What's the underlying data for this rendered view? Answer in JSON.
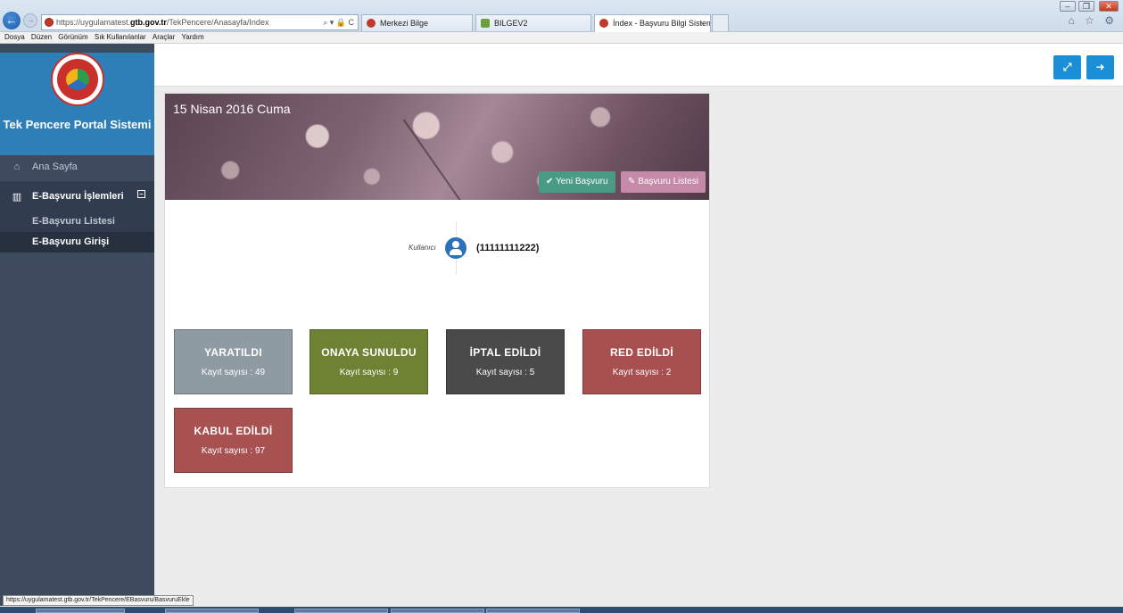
{
  "browser": {
    "url_prefix": "https://uygulamatest.",
    "url_host": "gtb.gov.tr",
    "url_path": "/TekPencere/Anasayfa/Index",
    "url_tools": "⌕ ▾ 🔒 C",
    "tabs": [
      {
        "label": "Merkezi Bilge"
      },
      {
        "label": "BILGEV2"
      },
      {
        "label": "İndex - Başvuru Bilgi Sistemi",
        "close": "×"
      }
    ],
    "menu": [
      "Dosya",
      "Düzen",
      "Görünüm",
      "Sık Kullanılanlar",
      "Araçlar",
      "Yardım"
    ],
    "window_controls": {
      "minimize": "–",
      "restore": "❐",
      "close": "✕"
    },
    "toolbar_icons": "⌂ ☆ ⚙",
    "status_url": "https://uygulamatest.gtb.gov.tr/TekPencere/EBasvuru/BasvuruEkle"
  },
  "sidebar": {
    "brand_title": "Tek Pencere Portal Sistemi",
    "home_label": "Ana Sayfa",
    "group_label": "E-Başvuru İşlemleri",
    "group_toggle": "–",
    "sub_items": [
      {
        "label": "E-Başvuru Listesi"
      },
      {
        "label": "E-Başvuru Girişi"
      }
    ],
    "icons": {
      "home": "home-icon",
      "chart": "bar-chart-icon"
    }
  },
  "topbar": {
    "expand_icon": "⤢",
    "logout_icon": "➜"
  },
  "hero": {
    "date": "15 Nisan 2016 Cuma",
    "new_btn": "✔ Yeni Başvuru",
    "list_btn": "✎ Başvuru Listesi"
  },
  "user": {
    "label": "Kullanıcı",
    "id": "(11111111222)"
  },
  "cards": [
    {
      "title": "YARATILDI",
      "sub": "Kayıt sayısı : 49",
      "color": "#8f9ba3"
    },
    {
      "title": "ONAYA SUNULDU",
      "sub": "Kayıt sayısı : 9",
      "color": "#6f8233"
    },
    {
      "title": "İPTAL EDİLDİ",
      "sub": "Kayıt sayısı : 5",
      "color": "#4a4a4a"
    },
    {
      "title": "RED EDİLDİ",
      "sub": "Kayıt sayısı : 2",
      "color": "#a84f4f"
    },
    {
      "title": "KABUL EDİLDİ",
      "sub": "Kayıt sayısı : 97",
      "color": "#a85151"
    }
  ],
  "colors": {
    "sidebar_bg": "#3e4a5e",
    "brand_bg": "#2e7eb8",
    "accent": "#1a8fd6"
  }
}
